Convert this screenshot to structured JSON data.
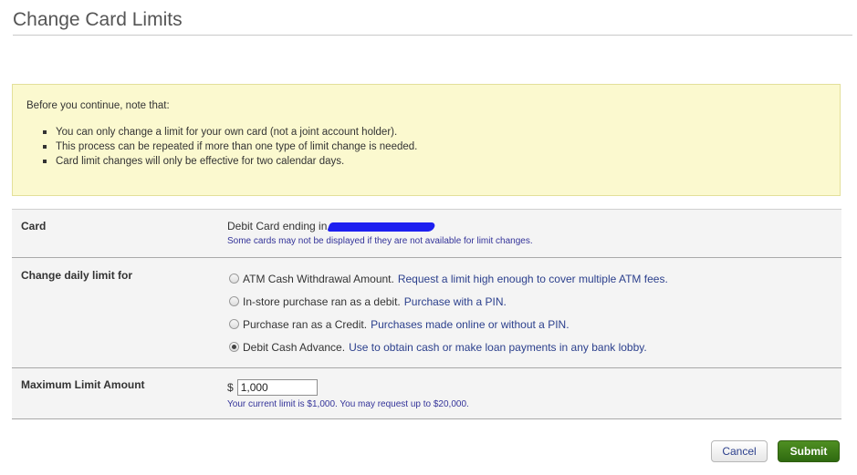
{
  "page": {
    "title": "Change Card Limits"
  },
  "notice": {
    "intro": "Before you continue, note that:",
    "items": [
      "You can only change a limit for your own card (not a joint account holder).",
      "This process can be repeated if more than one type of limit change is needed.",
      "Card limit changes will only be effective for two calendar days."
    ]
  },
  "card_row": {
    "label": "Card",
    "value_prefix": "Debit Card ending in",
    "hint": "Some cards may not be displayed if they are not available for limit changes."
  },
  "limit_row": {
    "label": "Change daily limit for",
    "options": [
      {
        "name": "ATM Cash Withdrawal Amount.",
        "description": "Request a limit high enough to cover multiple ATM fees.",
        "checked": false
      },
      {
        "name": "In-store purchase ran as a debit.",
        "description": "Purchase with a PIN.",
        "checked": false
      },
      {
        "name": "Purchase ran as a Credit.",
        "description": "Purchases made online or without a PIN.",
        "checked": false
      },
      {
        "name": "Debit Cash Advance.",
        "description": "Use to obtain cash or make loan payments in any bank lobby.",
        "checked": true
      }
    ]
  },
  "amount_row": {
    "label": "Maximum Limit Amount",
    "currency": "$",
    "value": "1,000",
    "hint": "Your current limit is $1,000. You may request up to $20,000."
  },
  "actions": {
    "cancel_label": "Cancel",
    "submit_label": "Submit"
  },
  "colors": {
    "notice_bg": "#fbf9cf",
    "submit_bg": "#3d7a18",
    "link": "#2b3f8c",
    "redaction": "#1d1ff0"
  }
}
